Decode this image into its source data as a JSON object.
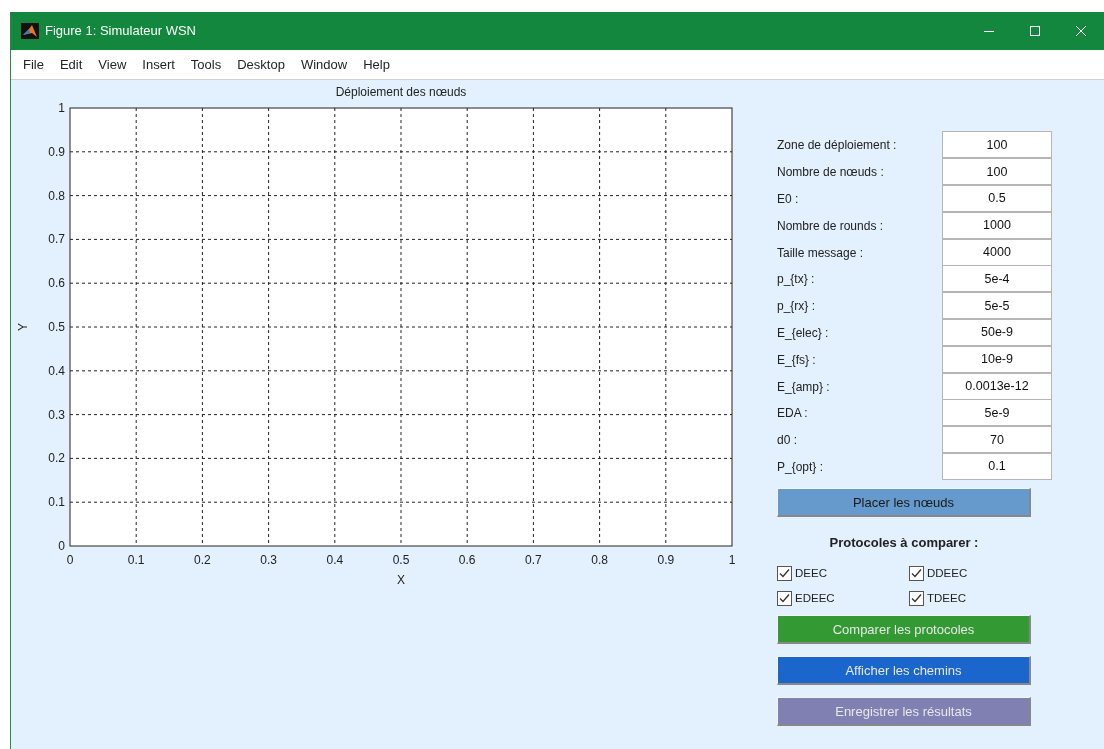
{
  "window": {
    "title": "Figure 1: Simulateur WSN"
  },
  "menu": [
    "File",
    "Edit",
    "View",
    "Insert",
    "Tools",
    "Desktop",
    "Window",
    "Help"
  ],
  "plot": {
    "chart_data": {
      "type": "scatter",
      "title": "Déploiement des nœuds",
      "xlabel": "X",
      "ylabel": "Y",
      "grid": true,
      "xlim": [
        0,
        1
      ],
      "ylim": [
        0,
        1
      ],
      "xticks": [
        0,
        0.1,
        0.2,
        0.3,
        0.4,
        0.5,
        0.6,
        0.7,
        0.8,
        0.9,
        1
      ],
      "yticks": [
        0,
        0.1,
        0.2,
        0.3,
        0.4,
        0.5,
        0.6,
        0.7,
        0.8,
        0.9,
        1
      ]
    }
  },
  "parameters": [
    {
      "label": "Zone de déploiement :",
      "value": "100"
    },
    {
      "label": "Nombre de nœuds :",
      "value": "100"
    },
    {
      "label": "E0 :",
      "value": "0.5"
    },
    {
      "label": "Nombre de rounds :",
      "value": "1000"
    },
    {
      "label": "Taille message :",
      "value": "4000"
    },
    {
      "label": "p_{tx} :",
      "value": "5e-4"
    },
    {
      "label": "p_{rx} :",
      "value": "5e-5"
    },
    {
      "label": "E_{elec} :",
      "value": "50e-9"
    },
    {
      "label": "E_{fs} :",
      "value": "10e-9"
    },
    {
      "label": "E_{amp} :",
      "value": "0.0013e-12"
    },
    {
      "label": "EDA :",
      "value": "5e-9"
    },
    {
      "label": "d0 :",
      "value": "70"
    },
    {
      "label": "P_{opt} :",
      "value": "0.1"
    }
  ],
  "place_button": {
    "label": "Placer les nœuds",
    "color": "#6699cc"
  },
  "protocols": {
    "title": "Protocoles à comparer :",
    "items": [
      {
        "label": "DEEC",
        "checked": true
      },
      {
        "label": "DDEEC",
        "checked": true
      },
      {
        "label": "EDEEC",
        "checked": true
      },
      {
        "label": "TDEEC",
        "checked": true
      }
    ]
  },
  "action_buttons": [
    {
      "label": "Comparer les protocoles",
      "color": "#339933"
    },
    {
      "label": "Afficher les chemins",
      "color": "#1a66cc"
    },
    {
      "label": "Enregistrer les résultats",
      "color": "#8080b3"
    }
  ]
}
